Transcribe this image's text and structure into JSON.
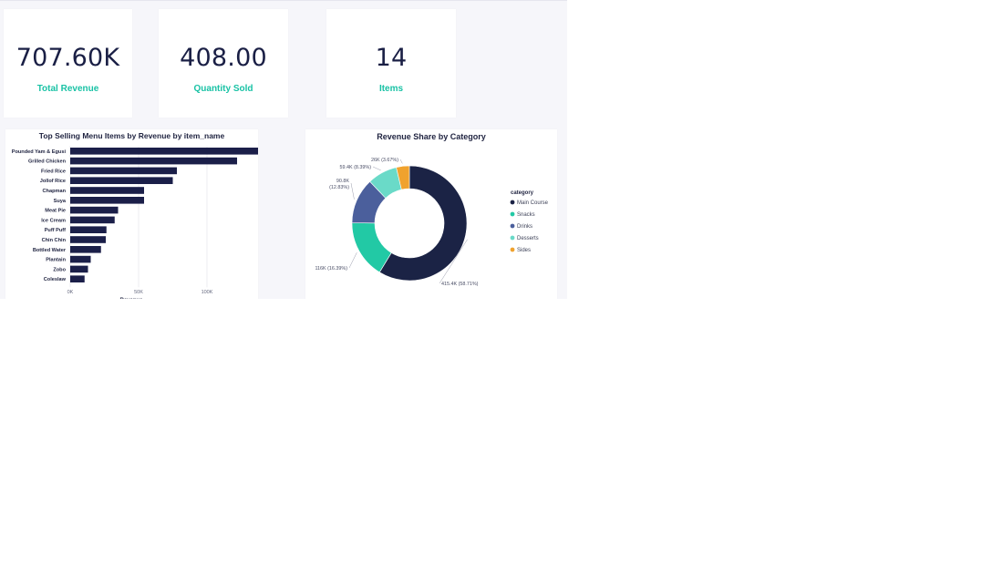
{
  "kpis": [
    {
      "value": "707.60K",
      "label": "Total Revenue"
    },
    {
      "value": "408.00",
      "label": "Quantity Sold"
    },
    {
      "value": "14",
      "label": "Items"
    }
  ],
  "chart_data": [
    {
      "type": "bar",
      "orientation": "horizontal",
      "title": "Top Selling Menu Items by Revenue by item_name",
      "xlabel": "Revenue",
      "ylabel": "",
      "categories": [
        "Pounded Yam & Egusi",
        "Grilled Chicken",
        "Fried Rice",
        "Jollof Rice",
        "Chapman",
        "Suya",
        "Meat Pie",
        "Ice Cream",
        "Puff Puff",
        "Chin Chin",
        "Bottled Water",
        "Plantain",
        "Zobo",
        "Coleslaw"
      ],
      "values": [
        139000,
        122000,
        78000,
        75000,
        54000,
        54000,
        35000,
        32500,
        26500,
        26000,
        22500,
        15000,
        13000,
        10500
      ],
      "xlim": [
        0,
        140000
      ],
      "xticks": [
        {
          "value": 0,
          "label": "0K"
        },
        {
          "value": 50000,
          "label": "50K"
        },
        {
          "value": 100000,
          "label": "100K"
        }
      ],
      "grid": true,
      "colors": {
        "bar": "#1b1f49",
        "grid": "#ececf2"
      }
    },
    {
      "type": "pie",
      "variant": "donut",
      "title": "Revenue Share by Category",
      "legend_title": "category",
      "legend_position": "right",
      "slices": [
        {
          "name": "Main Course",
          "value": 415.4,
          "label": "415.4K (58.71%)",
          "color": "#1b2345"
        },
        {
          "name": "Snacks",
          "value": 116,
          "label": "116K (16.39%)",
          "color": "#22c9a5"
        },
        {
          "name": "Drinks",
          "value": 90.8,
          "label": "90.8K (12.83%)",
          "color": "#4b5f9c"
        },
        {
          "name": "Desserts",
          "value": 59.4,
          "label": "59.4K (8.39%)",
          "color": "#6adac8"
        },
        {
          "name": "Sides",
          "value": 26,
          "label": "26K (3.67%)",
          "color": "#f0a22e"
        }
      ]
    }
  ]
}
